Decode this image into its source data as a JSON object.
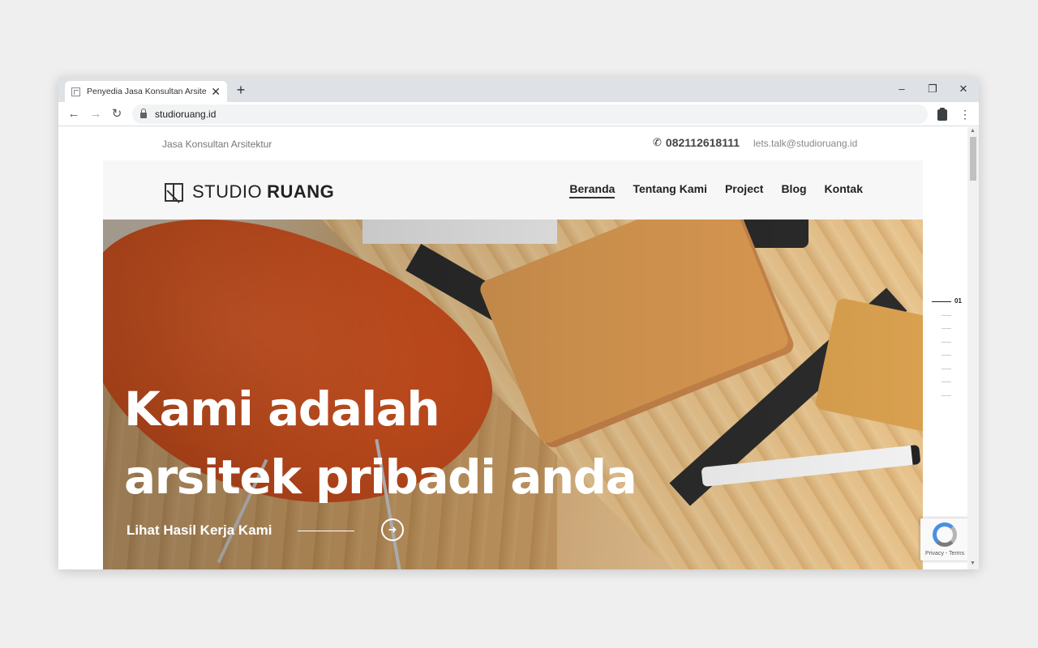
{
  "browser": {
    "tab_title": "Penyedia Jasa Konsultan Arsitektur",
    "url": "studioruang.id"
  },
  "topbar": {
    "tagline": "Jasa Konsultan Arsitektur",
    "phone": "082112618111",
    "email": "lets.talk@studioruang.id"
  },
  "brand": {
    "light": "STUDIO",
    "bold": "RUANG"
  },
  "nav": {
    "items": [
      {
        "label": "Beranda",
        "active": true
      },
      {
        "label": "Tentang Kami",
        "active": false
      },
      {
        "label": "Project",
        "active": false
      },
      {
        "label": "Blog",
        "active": false
      },
      {
        "label": "Kontak",
        "active": false
      }
    ]
  },
  "hero": {
    "line1": "Kami adalah",
    "line2": "arsitek pribadi anda",
    "cta": "Lihat Hasil Kerja Kami"
  },
  "pager": {
    "current": "01",
    "total_slides": 8
  },
  "recaptcha": {
    "text": "Privacy - Terms"
  },
  "colors": {
    "accent": "#222222",
    "hero_chair": "#d4531f"
  }
}
